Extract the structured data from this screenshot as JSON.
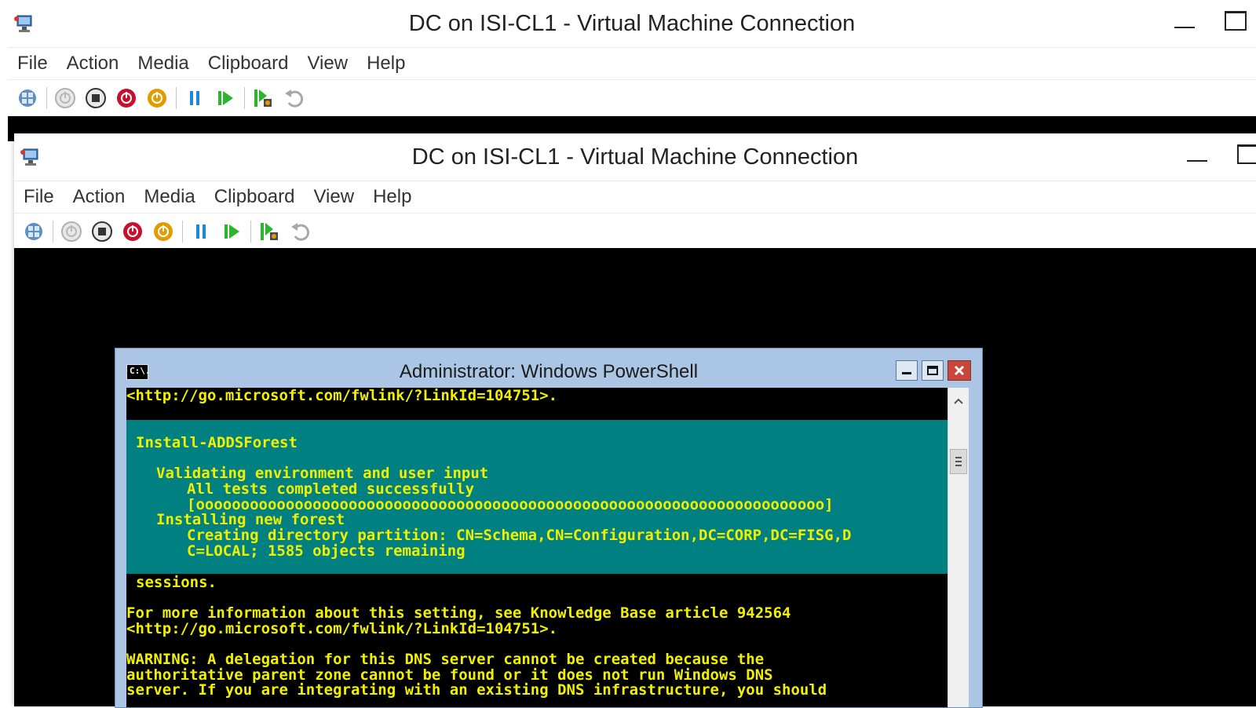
{
  "vm_back": {
    "title": "DC on ISI-CL1 - Virtual Machine Connection",
    "menu": [
      "File",
      "Action",
      "Media",
      "Clipboard",
      "View",
      "Help"
    ]
  },
  "vm_front": {
    "title": "DC on ISI-CL1 - Virtual Machine Connection",
    "menu": [
      "File",
      "Action",
      "Media",
      "Clipboard",
      "View",
      "Help"
    ]
  },
  "toolbar_icons": [
    "ctrl-alt-del-icon",
    "start-icon",
    "turn-off-icon",
    "shut-down-icon",
    "save-icon",
    "pause-icon",
    "resume-icon",
    "checkpoint-icon",
    "revert-icon"
  ],
  "powershell": {
    "title": "Administrator: Windows PowerShell",
    "icon_text": "C:\\.",
    "console_lines": [
      "<http://go.microsoft.com/fwlink/?LinkId=104751>.",
      "sessions.",
      "For more information about this setting, see Knowledge Base article 942564",
      "<http://go.microsoft.com/fwlink/?LinkId=104751>.",
      "WARNING: A delegation for this DNS server cannot be created because the",
      "authoritative parent zone cannot be found or it does not run Windows DNS",
      "server. If you are integrating with an existing DNS infrastructure, you should"
    ],
    "progress": {
      "activity": "Install-ADDSForest",
      "step1": "Validating environment and user input",
      "step1_status": "All tests completed successfully",
      "bar": "[oooooooooooooooooooooooooooooooooooooooooooooooooooooooooooooooooooooo]",
      "step2": "Installing new forest",
      "step2_status_1": "Creating directory partition: CN=Schema,CN=Configuration,DC=CORP,DC=FISG,D",
      "step2_status_2": "C=LOCAL; 1585 objects remaining"
    }
  }
}
